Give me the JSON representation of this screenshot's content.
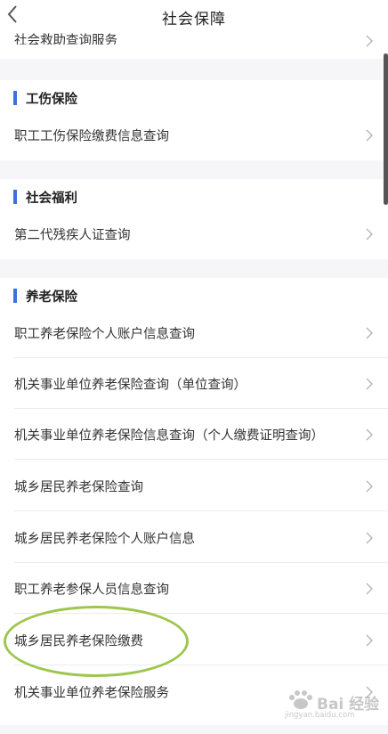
{
  "header": {
    "title": "社会保障",
    "back_icon": "chevron-left-icon"
  },
  "top_item": {
    "label": "社会救助查询服务"
  },
  "sections": {
    "injury": {
      "title": "工伤保险",
      "items": [
        {
          "label": "职工工伤保险缴费信息查询"
        }
      ]
    },
    "welfare": {
      "title": "社会福利",
      "items": [
        {
          "label": "第二代残疾人证查询"
        }
      ]
    },
    "pension": {
      "title": "养老保险",
      "items": [
        {
          "label": "职工养老保险个人账户信息查询"
        },
        {
          "label": "机关事业单位养老保险查询（单位查询）"
        },
        {
          "label": "机关事业单位养老保险信息查询（个人缴费证明查询）"
        },
        {
          "label": "城乡居民养老保险查询"
        },
        {
          "label": "城乡居民养老保险个人账户信息"
        },
        {
          "label": "职工养老参保人员信息查询"
        },
        {
          "label": "城乡居民养老保险缴费"
        },
        {
          "label": "机关事业单位养老保险服务"
        }
      ]
    }
  },
  "watermark": {
    "text": "Bai 经验",
    "url": "jingyan.baidu.com"
  },
  "colors": {
    "accent_bar": "#3d6fe0",
    "highlight_circle": "#9ec64c",
    "section_gap": "#f6f6f8"
  }
}
